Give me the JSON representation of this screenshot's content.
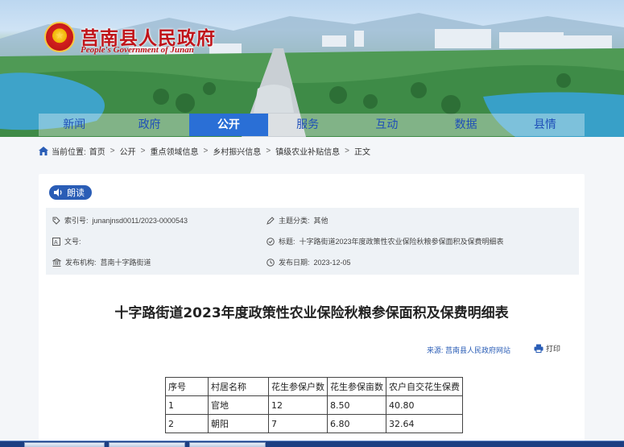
{
  "site": {
    "name_cn": "莒南县人民政府",
    "name_en": "People's Government of Junan"
  },
  "nav": {
    "items": [
      {
        "label": "新闻",
        "active": false
      },
      {
        "label": "政府",
        "active": false
      },
      {
        "label": "公开",
        "active": true
      },
      {
        "label": "服务",
        "active": false
      },
      {
        "label": "互动",
        "active": false
      },
      {
        "label": "数据",
        "active": false
      },
      {
        "label": "县情",
        "active": false
      }
    ]
  },
  "breadcrumb": {
    "prefix": "当前位置:",
    "items": [
      "首页",
      "公开",
      "重点领域信息",
      "乡村振兴信息",
      "镇级农业补贴信息",
      "正文"
    ]
  },
  "read_button": {
    "label": "朗读"
  },
  "meta": {
    "index_label": "索引号:",
    "index_value": "junanjnsd0011/2023-0000543",
    "topic_label": "主题分类:",
    "topic_value": "其他",
    "docno_label": "文号:",
    "docno_value": "",
    "title_label": "标题:",
    "title_value": "十字路街道2023年度政策性农业保险秋粮参保面积及保费明细表",
    "org_label": "发布机构:",
    "org_value": "莒南十字路街道",
    "date_label": "发布日期:",
    "date_value": "2023-12-05"
  },
  "article": {
    "title": "十字路街道2023年度政策性农业保险秋粮参保面积及保费明细表",
    "source": "来源: 莒南县人民政府网站",
    "print_label": "打印"
  },
  "table": {
    "headers": [
      "序号",
      "村居名称",
      "花生参保户数",
      "花生参保亩数",
      "农户自交花生保费"
    ],
    "rows": [
      [
        "1",
        "官地",
        "12",
        "8.50",
        "40.80"
      ],
      [
        "2",
        "朝阳",
        "7",
        "6.80",
        "32.64"
      ]
    ]
  },
  "colors": {
    "accent": "#2a5db6",
    "nav_active": "#2a6fd6",
    "logo_red": "#c0141a"
  }
}
